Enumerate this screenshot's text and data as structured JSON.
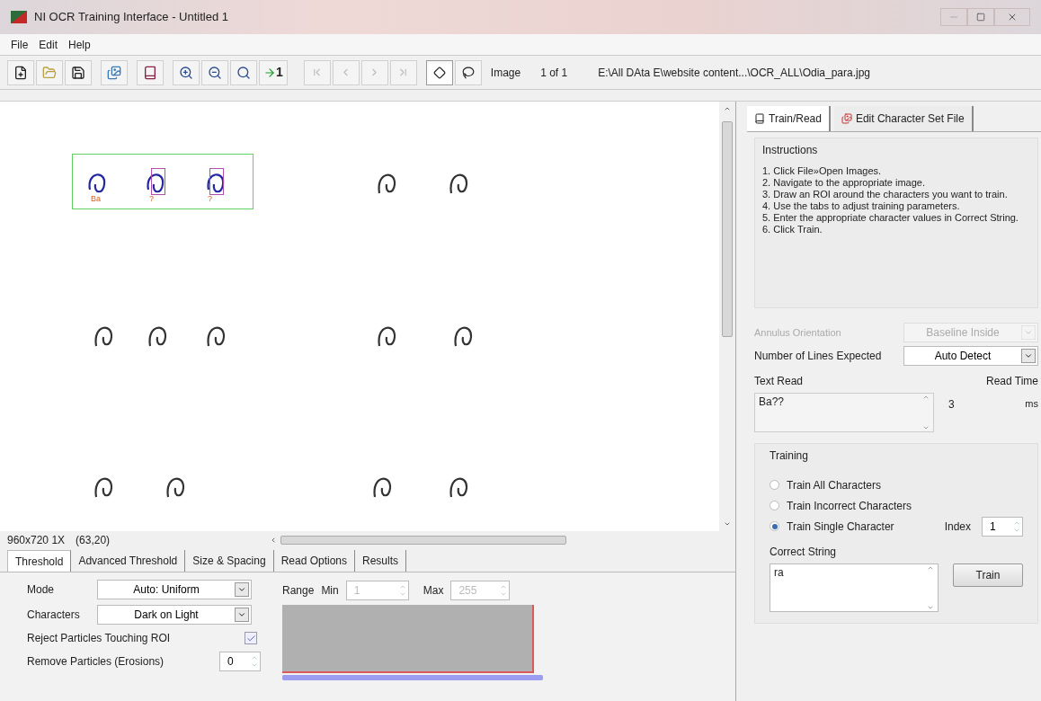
{
  "window": {
    "title": "NI OCR Training Interface - Untitled 1"
  },
  "menu": [
    "File",
    "Edit",
    "Help"
  ],
  "toolbar": {
    "goto_label": "1",
    "nav_disabled": true,
    "tools": [
      {
        "selected": true
      },
      {
        "selected": false
      }
    ],
    "image_label": "Image",
    "counter": "1 of 1",
    "path": "E:\\All DAta E\\website content...\\OCR_ALL\\Odia_para.jpg"
  },
  "canvas": {
    "roi_labels": [
      {
        "label": "Ba",
        "boxed": false
      },
      {
        "label": "?",
        "boxed": true
      },
      {
        "label": "?",
        "boxed": true
      }
    ]
  },
  "status": {
    "size": "960x720 1X",
    "coords": "(63,20)"
  },
  "bottom_tabs": [
    {
      "label": "Threshold",
      "selected": true
    },
    {
      "label": "Advanced Threshold",
      "selected": false
    },
    {
      "label": "Size & Spacing",
      "selected": false
    },
    {
      "label": "Read Options",
      "selected": false
    },
    {
      "label": "Results",
      "selected": false
    }
  ],
  "threshold": {
    "mode": {
      "label": "Mode",
      "value": "Auto: Uniform"
    },
    "characters": {
      "label": "Characters",
      "value": "Dark on Light"
    },
    "reject": {
      "label": "Reject Particles Touching ROI",
      "checked": true
    },
    "erosions": {
      "label": "Remove Particles (Erosions)",
      "value": "0"
    },
    "range": {
      "label": "Range",
      "min_label": "Min",
      "min": "1",
      "max_label": "Max",
      "max": "255",
      "disabled": true,
      "level": 1
    }
  },
  "side_tabs": [
    {
      "label": "Train/Read",
      "selected": true
    },
    {
      "label": "Edit Character Set File",
      "selected": false
    }
  ],
  "instructions": {
    "title": "Instructions",
    "lines": [
      "1. Click File»Open Images.",
      "2. Navigate to the appropriate image.",
      "3. Draw an ROI around the characters you want to train.",
      "4. Use the tabs to adjust training parameters.",
      "5. Enter the appropriate character values in Correct String.",
      "6. Click Train."
    ]
  },
  "annulus": {
    "label": "Annulus Orientation",
    "value": "Baseline Inside",
    "disabled": true
  },
  "lines_expected": {
    "label": "Number of Lines Expected",
    "value": "Auto Detect",
    "disabled": false
  },
  "text_read": {
    "label": "Text Read",
    "value": "Ba??"
  },
  "read_time": {
    "label": "Read Time",
    "value": "3",
    "unit": "ms"
  },
  "training": {
    "title": "Training",
    "options": [
      {
        "label": "Train All Characters",
        "selected": false
      },
      {
        "label": "Train Incorrect Characters",
        "selected": false
      },
      {
        "label": "Train Single Character",
        "selected": true
      }
    ],
    "index_label": "Index",
    "index": "1",
    "correct_label": "Correct String",
    "correct": "ra",
    "train_button": "Train"
  }
}
